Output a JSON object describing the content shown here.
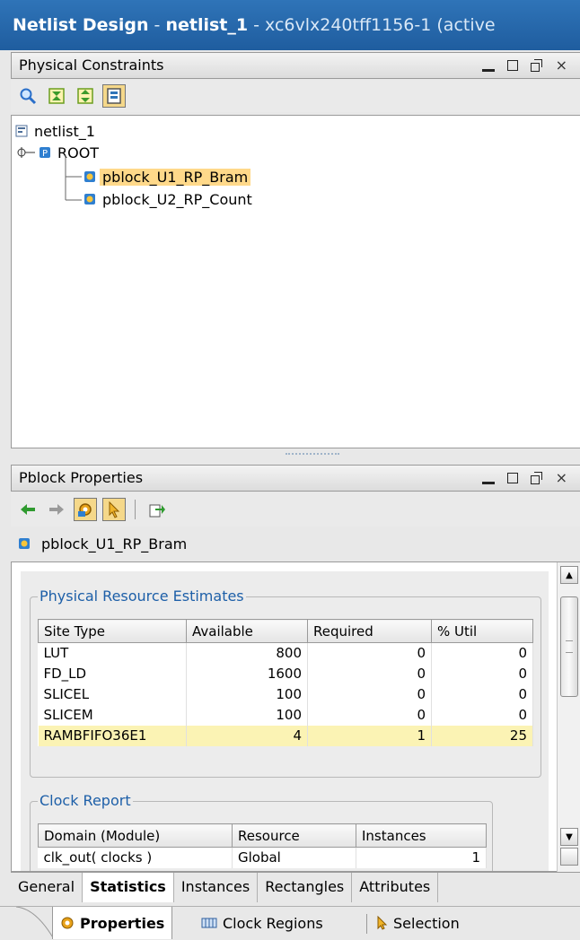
{
  "window": {
    "title_app": "Netlist Design",
    "title_sep": " - ",
    "title_design": "netlist_1",
    "title_part": " - xc6vlx240tff1156-1 (active"
  },
  "physical_constraints": {
    "header": "Physical Constraints",
    "tree": {
      "root_label": "netlist_1",
      "root_node": "ROOT",
      "items": [
        {
          "label": "pblock_U1_RP_Bram",
          "selected": true
        },
        {
          "label": "pblock_U2_RP_Count",
          "selected": false
        }
      ]
    }
  },
  "pblock_properties": {
    "header": "Pblock Properties",
    "selected_name": "pblock_U1_RP_Bram",
    "resource_group": {
      "title": "Physical Resource Estimates",
      "columns": [
        "Site Type",
        "Available",
        "Required",
        "% Util"
      ],
      "rows": [
        [
          "LUT",
          "800",
          "0",
          "0"
        ],
        [
          "FD_LD",
          "1600",
          "0",
          "0"
        ],
        [
          "SLICEL",
          "100",
          "0",
          "0"
        ],
        [
          "SLICEM",
          "100",
          "0",
          "0"
        ],
        [
          "RAMBFIFO36E1",
          "4",
          "1",
          "25"
        ]
      ]
    },
    "clock_group": {
      "title": "Clock Report",
      "columns": [
        "Domain (Module)",
        "Resource",
        "Instances"
      ],
      "rows": [
        [
          "clk_out( clocks )",
          "Global",
          "1"
        ]
      ]
    },
    "tabs": [
      "General",
      "Statistics",
      "Instances",
      "Rectangles",
      "Attributes"
    ],
    "active_tab": "Statistics"
  },
  "bottom_tabs": {
    "properties": "Properties",
    "clock_regions": "Clock Regions",
    "selection": "Selection"
  },
  "colors": {
    "titlebar": "#1f5d9f",
    "selection": "#ffd98a",
    "row_highlight": "#fbf3b4",
    "group_title": "#1d5fa8"
  }
}
